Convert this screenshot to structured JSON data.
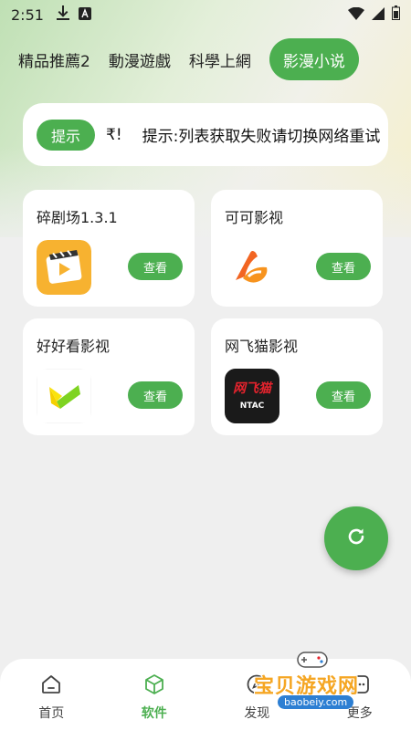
{
  "status_bar": {
    "time": "2:51",
    "icons": [
      "download-icon",
      "a-icon",
      "wifi-icon",
      "signal-icon",
      "battery-icon"
    ]
  },
  "tabs": [
    {
      "label": "精品推薦2",
      "active": false
    },
    {
      "label": "動漫遊戲",
      "active": false
    },
    {
      "label": "科學上網",
      "active": false
    },
    {
      "label": "影漫小说",
      "active": true
    }
  ],
  "notice": {
    "badge": "提示",
    "tail": "₹!",
    "text": "提示:列表获取失败请切换网络重试"
  },
  "cards": [
    {
      "title": "碎剧场1.3.1",
      "button": "查看",
      "logo": "film-play-logo"
    },
    {
      "title": "可可影视",
      "button": "查看",
      "logo": "keke-logo"
    },
    {
      "title": "好好看影视",
      "button": "查看",
      "logo": "haohaokan-logo"
    },
    {
      "title": "网飞猫影视",
      "button": "查看",
      "logo": "wangfeimao-logo",
      "logo_text": "网飞猫",
      "logo_sub": "NTAC"
    }
  ],
  "fab": {
    "icon": "refresh-icon"
  },
  "bottom_nav": [
    {
      "label": "首页",
      "icon": "home-icon",
      "active": false
    },
    {
      "label": "软件",
      "icon": "box-icon",
      "active": true
    },
    {
      "label": "发现",
      "icon": "compass-icon",
      "active": false
    },
    {
      "label": "更多",
      "icon": "more-icon",
      "active": false
    }
  ],
  "watermark": {
    "text": "宝贝游戏网",
    "url": "baobeiy.com"
  },
  "colors": {
    "accent": "#4caf50",
    "orange": "#f7b230",
    "logo_dark": "#1a1a1a"
  }
}
